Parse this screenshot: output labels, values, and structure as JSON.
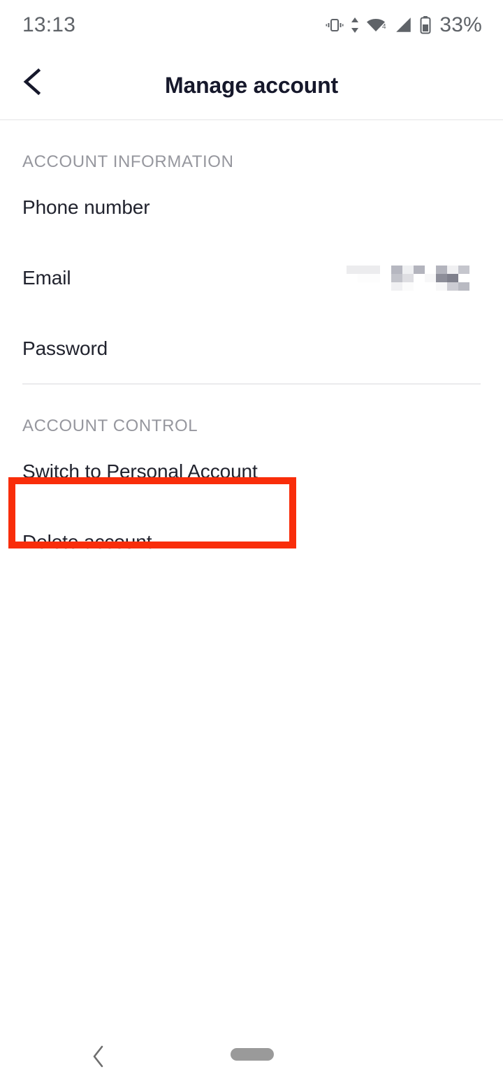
{
  "status_bar": {
    "time": "13:13",
    "battery_percent": "33%",
    "wifi_label": "4",
    "icons": [
      "vibrate-icon",
      "data-transfer-icon",
      "wifi-icon",
      "cell-signal-icon",
      "battery-icon"
    ]
  },
  "app_bar": {
    "title": "Manage account",
    "back_icon": "chevron-left-icon"
  },
  "sections": [
    {
      "header": "ACCOUNT INFORMATION",
      "rows": [
        {
          "label": "Phone number",
          "value": "",
          "redacted": false
        },
        {
          "label": "Email",
          "value": "",
          "redacted": true
        },
        {
          "label": "Password",
          "value": "",
          "redacted": false
        }
      ]
    },
    {
      "header": "ACCOUNT CONTROL",
      "rows": [
        {
          "label": "Switch to Personal Account",
          "value": "",
          "redacted": false
        },
        {
          "label": "Delete account",
          "value": "",
          "redacted": false
        }
      ]
    }
  ],
  "annotation": {
    "color": "#f92d0a",
    "target_label": "Switch to Personal Account"
  },
  "nav_bar": {
    "back_icon": "chevron-left-icon",
    "home_indicator": "home-pill-indicator"
  },
  "colors": {
    "background": "#ffffff",
    "primary_text": "#21232e",
    "title_text": "#16182b",
    "muted_text": "#96979e",
    "status_text": "#5f6368",
    "divider": "#d8d9dd",
    "accent_red": "#f92d0a"
  }
}
